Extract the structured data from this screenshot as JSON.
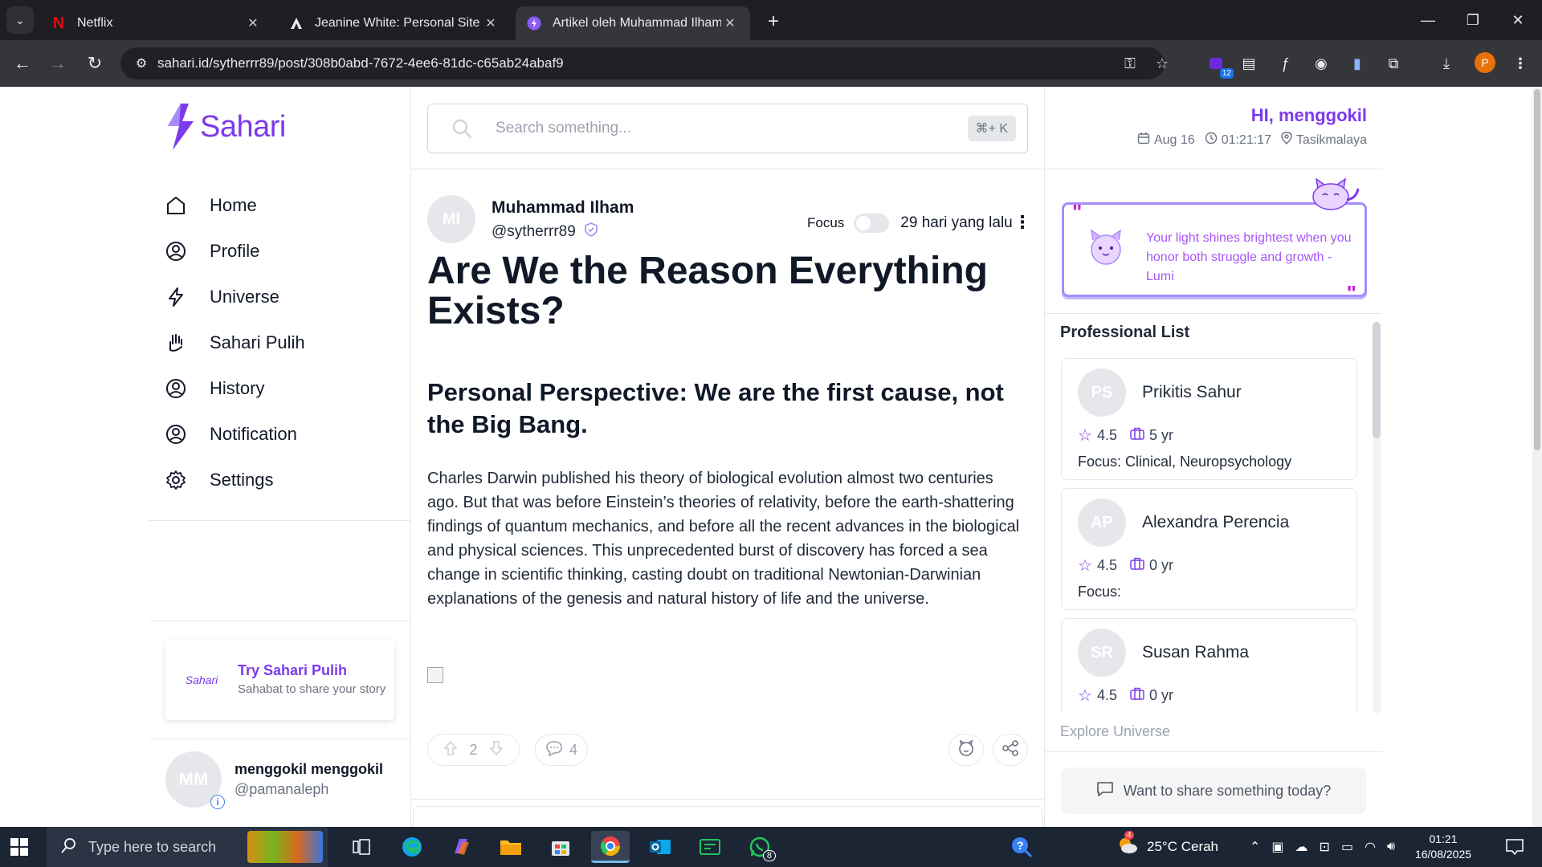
{
  "browser": {
    "tabs": [
      {
        "title": "Netflix",
        "active": false
      },
      {
        "title": "Jeanine White: Personal Site",
        "active": false
      },
      {
        "title": "Artikel oleh Muhammad Ilham",
        "active": true
      }
    ],
    "url": "sahari.id/sytherrr89/post/308b0abd-7672-4ee6-81dc-c65ab24abaf9",
    "extension_badge": "12",
    "profile_initial": "P"
  },
  "logo": {
    "text": "Sahari"
  },
  "sidebar": {
    "items": [
      {
        "label": "Home",
        "icon": "home-icon"
      },
      {
        "label": "Profile",
        "icon": "user-circle-icon"
      },
      {
        "label": "Universe",
        "icon": "bolt-icon"
      },
      {
        "label": "Sahari Pulih",
        "icon": "hand-icon"
      },
      {
        "label": "History",
        "icon": "user-circle-icon"
      },
      {
        "label": "Notification",
        "icon": "user-circle-icon"
      },
      {
        "label": "Settings",
        "icon": "gear-icon"
      }
    ],
    "promo": {
      "logo": "Sahari",
      "title": "Try Sahari Pulih",
      "subtitle": "Sahabat to share your story"
    },
    "user": {
      "initials": "MM",
      "name": "menggokil menggokil",
      "handle": "@pamanaleph"
    }
  },
  "search": {
    "placeholder": "Search something...",
    "shortcut": "⌘+ K"
  },
  "post": {
    "author": {
      "initials": "MI",
      "name": "Muhammad Ilham",
      "handle": "@sytherrr89"
    },
    "focus_label": "Focus",
    "time_ago": "29 hari yang lalu",
    "title": "Are We the Reason Everything Exists?",
    "subtitle": "Personal Perspective: We are the first cause, not the Big Bang.",
    "body": "Charles Darwin published his theory of biological evolution almost two centuries ago. But that was before Einstein’s theories of relativity, before the earth-shattering findings of quantum mechanics, and before all the recent advances in the biological and physical sciences. This unprecedented burst of discovery has forced a sea change in scientific thinking, casting doubt on traditional Newtonian-Darwinian explanations of the genesis and natural history of life and the universe.",
    "votes": "2",
    "comments": "4"
  },
  "right": {
    "greeting": "HI, menggokil",
    "date": "Aug 16",
    "time": "01:21:17",
    "location": "Tasikmalaya",
    "quote": "Your light shines brightest when you honor both struggle and growth - Lumi",
    "professional_title": "Professional List",
    "professionals": [
      {
        "initials": "PS",
        "name": "Prikitis Sahur",
        "rating": "4.5",
        "years": "5 yr",
        "focus": "Focus: Clinical, Neuropsychology"
      },
      {
        "initials": "AP",
        "name": "Alexandra Perencia",
        "rating": "4.5",
        "years": "0 yr",
        "focus": "Focus:"
      },
      {
        "initials": "SR",
        "name": "Susan Rahma",
        "rating": "4.5",
        "years": "0 yr",
        "focus": ""
      }
    ],
    "explore": "Explore Universe",
    "share_prompt": "Want to share something today?"
  },
  "taskbar": {
    "search_placeholder": "Type here to search",
    "whatsapp_badge": "8",
    "weather_badge": "4",
    "weather": "25°C  Cerah",
    "clock_time": "01:21",
    "clock_date": "16/08/2025"
  },
  "colors": {
    "accent": "#7c3aed",
    "quote_text": "#a855f7",
    "taskbar": "#1c2534",
    "chrome": "#35363a"
  }
}
